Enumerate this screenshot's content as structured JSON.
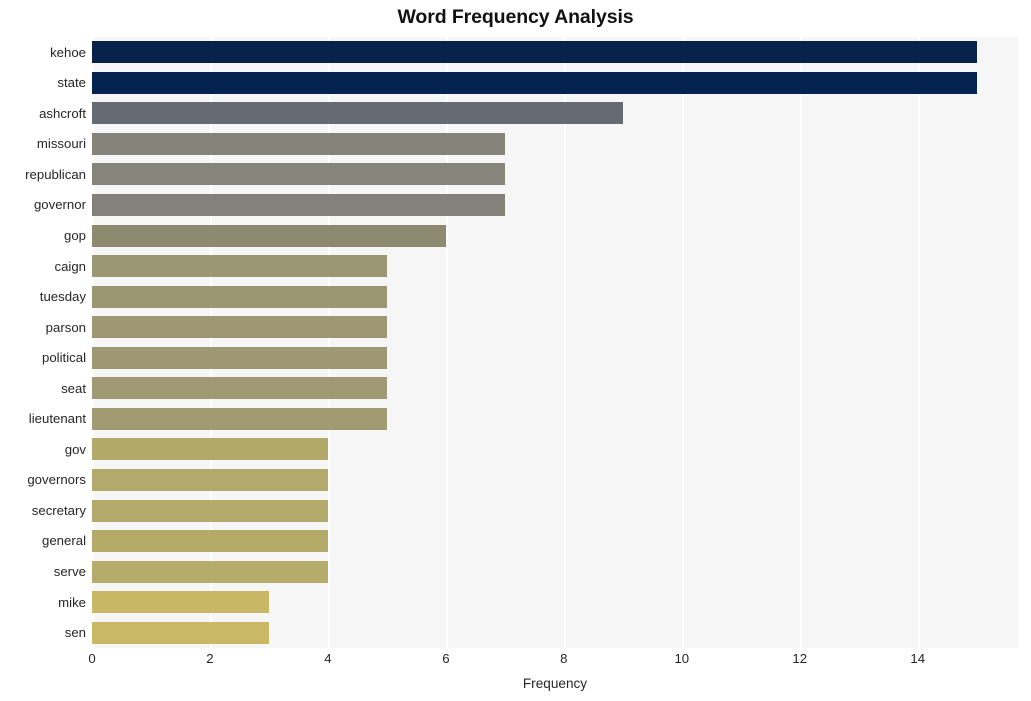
{
  "chart_data": {
    "type": "bar",
    "orientation": "horizontal",
    "title": "Word Frequency Analysis",
    "xlabel": "Frequency",
    "ylabel": "",
    "xlim": [
      0,
      15.7
    ],
    "ylim": [
      0,
      20
    ],
    "xticks": [
      0,
      2,
      4,
      6,
      8,
      10,
      12,
      14
    ],
    "xtick_labels": [
      "0",
      "2",
      "4",
      "6",
      "8",
      "10",
      "12",
      "14"
    ],
    "grid": "vertical",
    "legend": "none",
    "background": "#f6f6f7",
    "gridline_color": "#ffffff",
    "categories": [
      "kehoe",
      "state",
      "ashcroft",
      "missouri",
      "republican",
      "governor",
      "gop",
      "caign",
      "tuesday",
      "parson",
      "political",
      "seat",
      "lieutenant",
      "gov",
      "governors",
      "secretary",
      "general",
      "serve",
      "mike",
      "sen"
    ],
    "values": [
      15,
      15,
      9,
      7,
      7,
      7,
      6,
      5,
      5,
      5,
      5,
      5,
      5,
      4,
      4,
      4,
      4,
      4,
      3,
      3
    ],
    "bar_colors": [
      "#07234c",
      "#04234e",
      "#666a72",
      "#85837a",
      "#86847b",
      "#83817a",
      "#8d8a6f",
      "#9b9673",
      "#9c9773",
      "#9d9774",
      "#9d9873",
      "#a09a74",
      "#a19b74",
      "#b2a868",
      "#b3a96a",
      "#b4aa6b",
      "#b4aa6a",
      "#b5ab6b",
      "#c8b765",
      "#c9b866"
    ],
    "palette_name": "cividis-like sequential",
    "data_points": [
      {
        "word": "kehoe",
        "frequency": 15
      },
      {
        "word": "state",
        "frequency": 15
      },
      {
        "word": "ashcroft",
        "frequency": 9
      },
      {
        "word": "missouri",
        "frequency": 7
      },
      {
        "word": "republican",
        "frequency": 7
      },
      {
        "word": "governor",
        "frequency": 7
      },
      {
        "word": "gop",
        "frequency": 6
      },
      {
        "word": "caign",
        "frequency": 5
      },
      {
        "word": "tuesday",
        "frequency": 5
      },
      {
        "word": "parson",
        "frequency": 5
      },
      {
        "word": "political",
        "frequency": 5
      },
      {
        "word": "seat",
        "frequency": 5
      },
      {
        "word": "lieutenant",
        "frequency": 5
      },
      {
        "word": "gov",
        "frequency": 4
      },
      {
        "word": "governors",
        "frequency": 4
      },
      {
        "word": "secretary",
        "frequency": 4
      },
      {
        "word": "general",
        "frequency": 4
      },
      {
        "word": "serve",
        "frequency": 4
      },
      {
        "word": "mike",
        "frequency": 3
      },
      {
        "word": "sen",
        "frequency": 3
      }
    ]
  }
}
